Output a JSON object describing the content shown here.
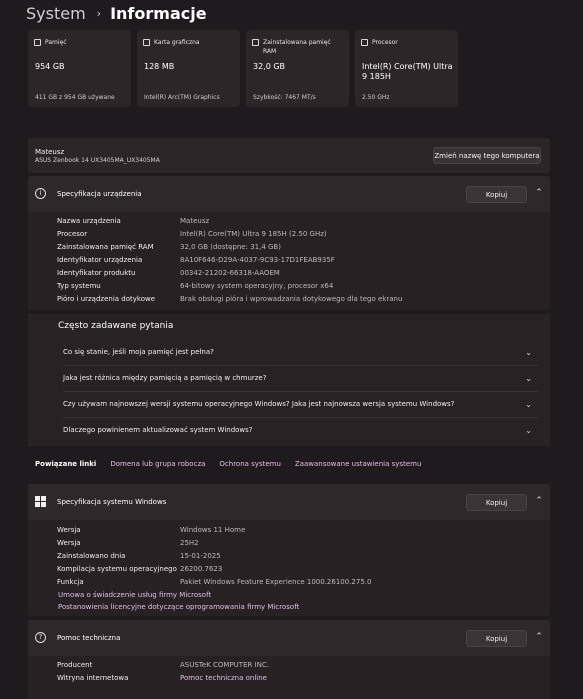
{
  "breadcrumb": {
    "parent": "System",
    "separator": "›",
    "current": "Informacje"
  },
  "cards": [
    {
      "icon": "storage-icon",
      "label": "Pamięć",
      "value": "954 GB",
      "sub": "411 GB z 954 GB używane"
    },
    {
      "icon": "graphics-card-icon",
      "label": "Karta graficzna",
      "value": "128 MB",
      "sub": "Intel(R) Arc(TM) Graphics"
    },
    {
      "icon": "ram-icon",
      "label": "Zainstalowana pamięć RAM",
      "value": "32,0 GB",
      "sub": "Szybkość: 7467 MT/s"
    },
    {
      "icon": "processor-icon",
      "label": "Procesor",
      "value": "Intel(R) Core(TM) Ultra 9 185H",
      "sub": "2.50 GHz"
    }
  ],
  "device": {
    "name": "Mateusz",
    "model": "ASUS Zenbook 14 UX3405MA_UX3405MA",
    "rename_button": "Zmień nazwę tego komputera"
  },
  "device_spec": {
    "title": "Specyfikacja urządzenia",
    "copy_button": "Kopiuj",
    "rows": [
      {
        "key": "Nazwa urządzenia",
        "value": "Mateusz"
      },
      {
        "key": "Procesor",
        "value": "Intel(R) Core(TM) Ultra 9 185H (2.50 GHz)"
      },
      {
        "key": "Zainstalowana pamięć RAM",
        "value": "32,0 GB (dostępne: 31,4 GB)"
      },
      {
        "key": "Identyfikator urządzenia",
        "value": "8A10F646-D29A-4037-9C93-17D1FEAB935F"
      },
      {
        "key": "Identyfikator produktu",
        "value": "00342-21202-66318-AAOEM"
      },
      {
        "key": "Typ systemu",
        "value": "64-bitowy system operacyjny, procesor x64"
      },
      {
        "key": "Pióro i urządzenia dotykowe",
        "value": "Brak obsługi pióra i wprowadzania dotykowego dla tego ekranu"
      }
    ]
  },
  "faq": {
    "title": "Często zadawane pytania",
    "items": [
      "Co się stanie, jeśli moja pamięć jest pełna?",
      "Jaka jest różnica między pamięcią a pamięcią w chmurze?",
      "Czy używam najnowszej wersji systemu operacyjnego Windows? Jaka jest najnowsza wersja systemu Windows?",
      "Dlaczego powinienem aktualizować system Windows?"
    ]
  },
  "related": {
    "label": "Powiązane linki",
    "links": [
      "Domena lub grupa robocza",
      "Ochrona systemu",
      "Zaawansowane ustawienia systemu"
    ]
  },
  "windows_spec": {
    "title": "Specyfikacja systemu Windows",
    "copy_button": "Kopiuj",
    "rows": [
      {
        "key": "Wersja",
        "value": "Windows 11 Home"
      },
      {
        "key": "Wersja",
        "value": "25H2"
      },
      {
        "key": "Zainstalowano dnia",
        "value": "15-01-2025"
      },
      {
        "key": "Kompilacja systemu operacyjnego",
        "value": "26200.7623"
      },
      {
        "key": "Funkcja",
        "value": "Pakiet Windows Feature Experience 1000.26100.275.0"
      }
    ],
    "links": [
      "Umowa o świadczenie usług firmy Microsoft",
      "Postanowienia licencyjne dotyczące oprogramowania firmy Microsoft"
    ]
  },
  "support": {
    "title": "Pomoc techniczna",
    "copy_button": "Kopiuj",
    "rows": [
      {
        "key": "Producent",
        "value": "ASUSTeK COMPUTER INC."
      },
      {
        "key": "Witryna internetowa",
        "value": "Pomoc techniczna online"
      }
    ]
  }
}
